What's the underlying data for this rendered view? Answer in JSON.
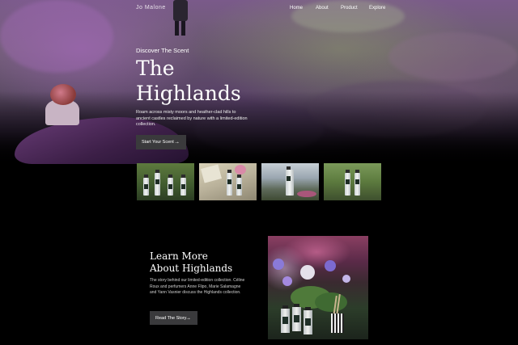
{
  "brand": {
    "logo": "Jo Malone"
  },
  "nav": {
    "items": [
      "Home",
      "About",
      "Product",
      "Explore"
    ]
  },
  "hero": {
    "eyebrow": "Discover The Scent",
    "title_line1": "The",
    "title_line2": "Highlands",
    "description": "Roam across misty moors and heather-clad hills to ancient castles reclaimed by nature with a limited-edition collection.",
    "button_label": "Start Your Scent",
    "button_icon": "arrow-right-icon"
  },
  "thumbnails": [
    {
      "name": "product-thumb-1"
    },
    {
      "name": "product-thumb-2"
    },
    {
      "name": "product-thumb-3"
    },
    {
      "name": "product-thumb-4"
    }
  ],
  "about": {
    "title_line1": "Learn More",
    "title_line2": "About Highlands",
    "description": "The story behind our limited-edition collection. Céline Roux and perfumers Anne Flipo, Marie Salamagne and Yann Vasnier discuss the Highlands collection.",
    "button_label": "Read The Story",
    "button_icon": "arrow-right-icon"
  },
  "colors": {
    "background": "#000000",
    "button": "#3a3a3c",
    "text": "#ffffff"
  }
}
